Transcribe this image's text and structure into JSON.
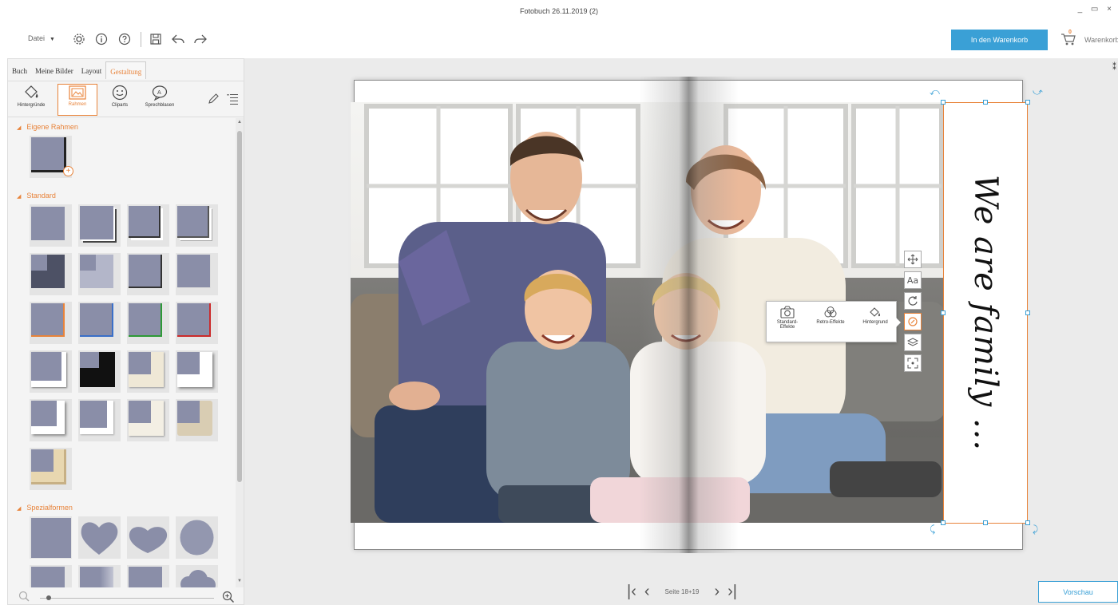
{
  "window": {
    "title": "Fotobuch 26.11.2019 (2)",
    "controls": "_ ▭ ×"
  },
  "toolbar": {
    "file_menu": "Datei",
    "icons": [
      "settings-gear-icon",
      "info-icon",
      "help-icon",
      "save-icon",
      "undo-icon",
      "redo-icon"
    ],
    "add_to_cart": "In den Warenkorb",
    "cart_label": "Warenkorb",
    "cart_count": "0"
  },
  "colors": {
    "accent": "#e8833a",
    "primary": "#3aa0d6",
    "frame_fill": "#8a8ea8"
  },
  "left_panel": {
    "tabs": [
      {
        "label": "Buch"
      },
      {
        "label": "Meine Bilder"
      },
      {
        "label": "Layout"
      },
      {
        "label": "Gestaltung"
      }
    ],
    "active_tab": "Gestaltung",
    "tools": [
      {
        "label": "Hintergründe",
        "icon": "paint-bucket-icon"
      },
      {
        "label": "Rahmen",
        "icon": "frame-icon"
      },
      {
        "label": "Cliparts",
        "icon": "smiley-icon"
      },
      {
        "label": "Sprechblasen",
        "icon": "speech-bubble-icon"
      }
    ],
    "sections": {
      "own": "Eigene Rahmen",
      "standard": "Standard",
      "special": "Spezialformen"
    }
  },
  "canvas": {
    "text_frame": "We are family ...",
    "side_tools": [
      "move-icon",
      "text-icon",
      "rotate-icon",
      "effects-icon",
      "layers-icon",
      "resize-icon"
    ],
    "effects": [
      {
        "label": "Standard-\nEffekte",
        "icon": "camera-icon"
      },
      {
        "label": "Retro-Effekte",
        "icon": "retro-circles-icon"
      },
      {
        "label": "Hintergrund",
        "icon": "paint-bucket-icon"
      }
    ]
  },
  "pager": {
    "label": "Seite 18+19",
    "first": "K",
    "prev": "‹",
    "next": "›",
    "last": "›|"
  },
  "preview_button": "Vorschau"
}
